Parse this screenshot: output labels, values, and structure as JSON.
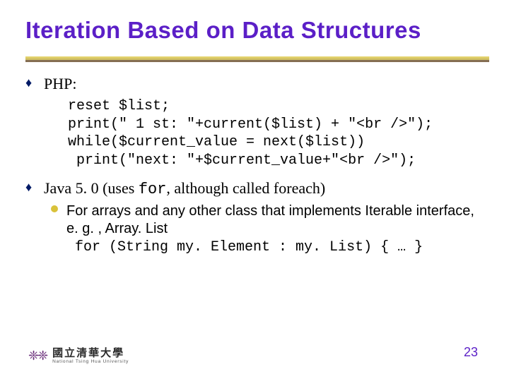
{
  "title": "Iteration Based on Data Structures",
  "bullets": {
    "php": {
      "label": "PHP:",
      "code": "reset $list;\nprint(\" 1 st: \"+current($list) + \"<br />\");\nwhile($current_value = next($list))\n print(\"next: \"+$current_value+\"<br />\");"
    },
    "java": {
      "prefix": "Java 5. 0 (uses ",
      "mono": "for",
      "suffix": ", although called foreach)",
      "sub": "For arrays and any other class that implements Iterable interface, e. g. , Array. List",
      "subcode": "for (String my. Element : my. List) { … }"
    }
  },
  "footer": {
    "logo_cn": "國立清華大學",
    "logo_en": "National Tsing Hua University"
  },
  "page": "23"
}
